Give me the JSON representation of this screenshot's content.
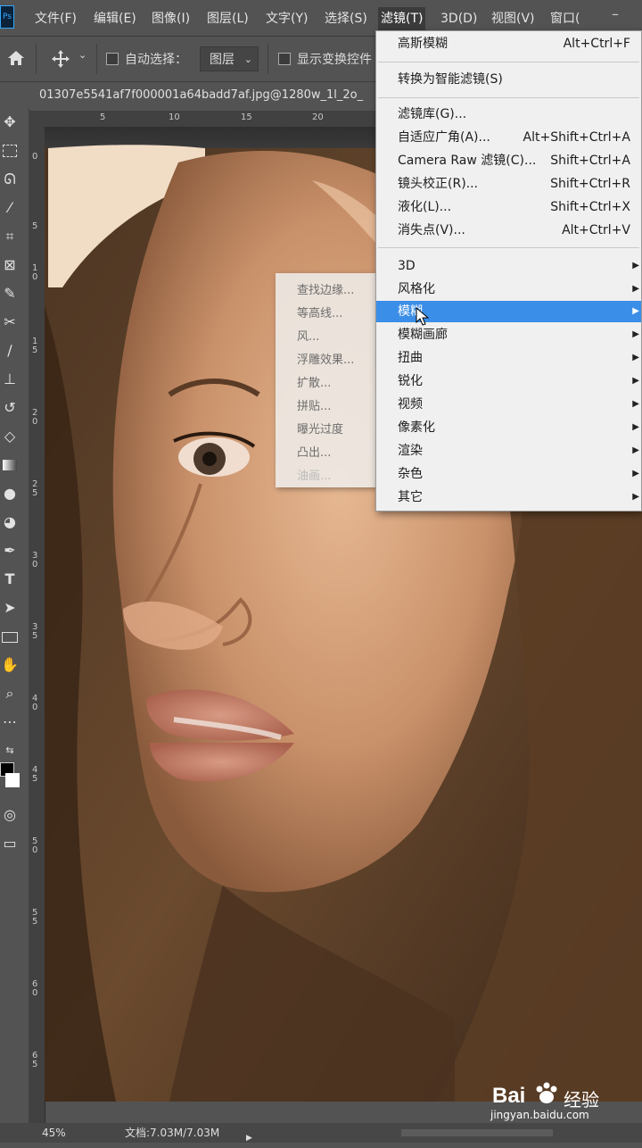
{
  "menubar": {
    "logo": "Ps",
    "items": [
      "文件(F)",
      "编辑(E)",
      "图像(I)",
      "图层(L)",
      "文字(Y)",
      "选择(S)",
      "滤镜(T)",
      "3D(D)",
      "视图(V)",
      "窗口("
    ],
    "active_index": 6
  },
  "options": {
    "auto_select_label": "自动选择：",
    "layer_select": "图层",
    "show_transform": "显示变换控件"
  },
  "document": {
    "tab_title": "01307e5541af7f000001a64badd7af.jpg@1280w_1l_2o_"
  },
  "ruler": {
    "top": [
      "5",
      "10",
      "15",
      "20"
    ],
    "left": [
      "0",
      "5",
      "1\n0",
      "1\n5",
      "2\n0",
      "2\n5",
      "3\n0",
      "3\n5",
      "4\n0",
      "4\n5",
      "5\n0",
      "5\n5",
      "6\n0",
      "6\n5"
    ]
  },
  "filter_menu": {
    "recent": {
      "label": "高斯模糊",
      "shortcut": "Alt+Ctrl+F"
    },
    "smart": {
      "label": "转换为智能滤镜(S)"
    },
    "group2": [
      {
        "label": "滤镜库(G)...",
        "shortcut": ""
      },
      {
        "label": "自适应广角(A)...",
        "shortcut": "Alt+Shift+Ctrl+A"
      },
      {
        "label": "Camera Raw 滤镜(C)...",
        "shortcut": "Shift+Ctrl+A"
      },
      {
        "label": "镜头校正(R)...",
        "shortcut": "Shift+Ctrl+R"
      },
      {
        "label": "液化(L)...",
        "shortcut": "Shift+Ctrl+X"
      },
      {
        "label": "消失点(V)...",
        "shortcut": "Alt+Ctrl+V"
      }
    ],
    "submenus": [
      "3D",
      "风格化",
      "模糊",
      "模糊画廊",
      "扭曲",
      "锐化",
      "视频",
      "像素化",
      "渲染",
      "杂色",
      "其它"
    ],
    "highlighted": "模糊"
  },
  "stylize_submenu": {
    "items": [
      "查找边缘...",
      "等高线...",
      "风...",
      "浮雕效果...",
      "扩散...",
      "拼贴...",
      "曝光过度",
      "凸出...",
      "油画..."
    ]
  },
  "status": {
    "zoom": "45%",
    "doc_size": "文档:7.03M/7.03M"
  },
  "watermark": {
    "brand": "Bai",
    "brand2": "经验",
    "url": "jingyan.baidu.com"
  }
}
